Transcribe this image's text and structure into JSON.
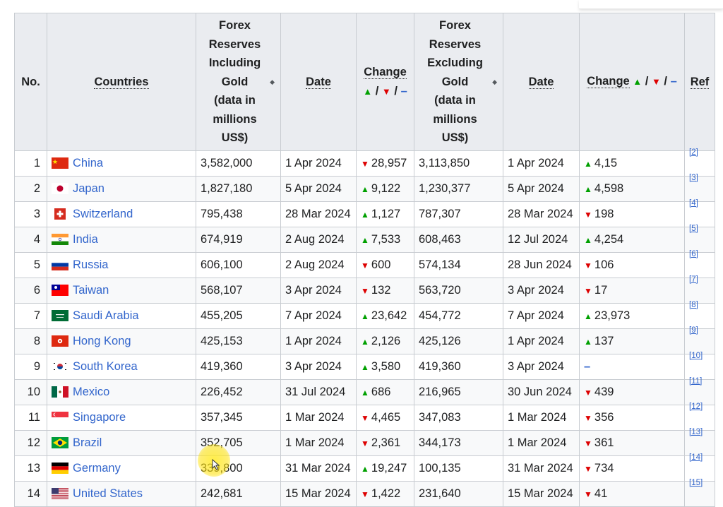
{
  "headers": {
    "no": "No.",
    "countries": "Countries",
    "forex_incl_lines": [
      "Forex",
      "Reserves",
      "Including",
      "Gold",
      "(data in",
      "millions",
      "US$)"
    ],
    "date1": "Date",
    "change1": "Change",
    "forex_excl_lines": [
      "Forex",
      "Reserves",
      "Excluding",
      "Gold",
      "(data in",
      "millions",
      "US$)"
    ],
    "date2": "Date",
    "change2": "Change",
    "ref": "Ref",
    "legend_sep": "/",
    "legend_dash": "–",
    "sort_glyph": "◆"
  },
  "rows": [
    {
      "no": "1",
      "country": "China",
      "flag": "china-flag",
      "incl": "3,582,000",
      "date1": "1 Apr 2024",
      "ch1_dir": "down",
      "ch1": "28,957",
      "excl": "3,113,850",
      "date2": "1 Apr 2024",
      "ch2_dir": "up",
      "ch2": "4,15",
      "ref": "[2]"
    },
    {
      "no": "2",
      "country": "Japan",
      "flag": "japan-flag",
      "incl": "1,827,180",
      "date1": "5 Apr 2024",
      "ch1_dir": "up",
      "ch1": "9,122",
      "excl": "1,230,377",
      "date2": "5 Apr 2024",
      "ch2_dir": "up",
      "ch2": "4,598",
      "ref": "[3]"
    },
    {
      "no": "3",
      "country": "Switzerland",
      "flag": "switzerland-flag",
      "incl": "795,438",
      "date1": "28 Mar 2024",
      "ch1_dir": "up",
      "ch1": "1,127",
      "excl": "787,307",
      "date2": "28 Mar 2024",
      "ch2_dir": "down",
      "ch2": "198",
      "ref": "[4]"
    },
    {
      "no": "4",
      "country": "India",
      "flag": "india-flag",
      "incl": "674,919",
      "date1": "2 Aug 2024",
      "ch1_dir": "up",
      "ch1": "7,533",
      "excl": "608,463",
      "date2": "12 Jul 2024",
      "ch2_dir": "up",
      "ch2": "4,254",
      "ref": "[5]"
    },
    {
      "no": "5",
      "country": "Russia",
      "flag": "russia-flag",
      "incl": "606,100",
      "date1": "2 Aug 2024",
      "ch1_dir": "down",
      "ch1": "600",
      "excl": "574,134",
      "date2": "28 Jun 2024",
      "ch2_dir": "down",
      "ch2": "106",
      "ref": "[6]"
    },
    {
      "no": "6",
      "country": "Taiwan",
      "flag": "taiwan-flag",
      "incl": "568,107",
      "date1": "3 Apr 2024",
      "ch1_dir": "down",
      "ch1": "132",
      "excl": "563,720",
      "date2": "3 Apr 2024",
      "ch2_dir": "down",
      "ch2": "17",
      "ref": "[7]"
    },
    {
      "no": "7",
      "country": "Saudi Arabia",
      "flag": "saudi-arabia-flag",
      "incl": "455,205",
      "date1": "7 Apr 2024",
      "ch1_dir": "up",
      "ch1": "23,642",
      "excl": "454,772",
      "date2": "7 Apr 2024",
      "ch2_dir": "up",
      "ch2": "23,973",
      "ref": "[8]"
    },
    {
      "no": "8",
      "country": "Hong Kong",
      "flag": "hong-kong-flag",
      "incl": "425,153",
      "date1": "1 Apr 2024",
      "ch1_dir": "up",
      "ch1": "2,126",
      "excl": "425,126",
      "date2": "1 Apr 2024",
      "ch2_dir": "up",
      "ch2": "137",
      "ref": "[9]"
    },
    {
      "no": "9",
      "country": "South Korea",
      "flag": "south-korea-flag",
      "incl": "419,360",
      "date1": "3 Apr 2024",
      "ch1_dir": "up",
      "ch1": "3,580",
      "excl": "419,360",
      "date2": "3 Apr 2024",
      "ch2_dir": "none",
      "ch2": "–",
      "ref": "[10]"
    },
    {
      "no": "10",
      "country": "Mexico",
      "flag": "mexico-flag",
      "incl": "226,452",
      "date1": "31 Jul 2024",
      "ch1_dir": "up",
      "ch1": "686",
      "excl": "216,965",
      "date2": "30 Jun 2024",
      "ch2_dir": "down",
      "ch2": "439",
      "ref": "[11]"
    },
    {
      "no": "11",
      "country": "Singapore",
      "flag": "singapore-flag",
      "incl": "357,345",
      "date1": "1 Mar 2024",
      "ch1_dir": "down",
      "ch1": "4,465",
      "excl": "347,083",
      "date2": "1 Mar 2024",
      "ch2_dir": "down",
      "ch2": "356",
      "ref": "[12]"
    },
    {
      "no": "12",
      "country": "Brazil",
      "flag": "brazil-flag",
      "incl": "352,705",
      "date1": "1 Mar 2024",
      "ch1_dir": "down",
      "ch1": "2,361",
      "excl": "344,173",
      "date2": "1 Mar 2024",
      "ch2_dir": "down",
      "ch2": "361",
      "ref": "[13]"
    },
    {
      "no": "13",
      "country": "Germany",
      "flag": "germany-flag",
      "incl": "339,800",
      "date1": "31 Mar 2024",
      "ch1_dir": "up",
      "ch1": "19,247",
      "excl": "100,135",
      "date2": "31 Mar 2024",
      "ch2_dir": "down",
      "ch2": "734",
      "ref": "[14]"
    },
    {
      "no": "14",
      "country": "United States",
      "flag": "united-states-flag",
      "incl": "242,681",
      "date1": "15 Mar 2024",
      "ch1_dir": "down",
      "ch1": "1,422",
      "excl": "231,640",
      "date2": "15 Mar 2024",
      "ch2_dir": "down",
      "ch2": "41",
      "ref": "[15]"
    }
  ],
  "colors": {
    "link": "#3366cc",
    "up": "#00a000",
    "down": "#dd0000",
    "header_bg": "#eaecf0",
    "border": "#c8ccd1"
  }
}
